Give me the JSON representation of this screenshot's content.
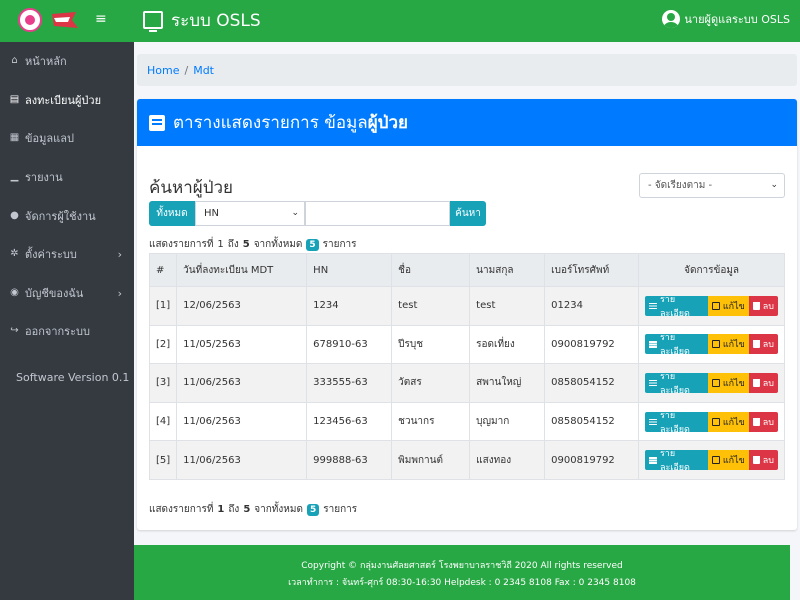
{
  "navbar": {
    "app_title": "ระบบ OSLS",
    "user_name": "นายผู้ดูแลระบบ OSLS"
  },
  "sidebar": {
    "items": [
      {
        "label": "หน้าหลัก",
        "icon": "home-icon"
      },
      {
        "label": "ลงทะเบียนผู้ป่วย",
        "icon": "id-card-icon"
      },
      {
        "label": "ข้อมูลแลป",
        "icon": "database-icon"
      },
      {
        "label": "รายงาน",
        "icon": "chart-icon"
      },
      {
        "label": "จัดการผู้ใช้งาน",
        "icon": "user-plus-icon"
      },
      {
        "label": "ตั้งค่าระบบ",
        "icon": "gears-icon"
      },
      {
        "label": "บัญชีของฉัน",
        "icon": "user-circle-icon"
      },
      {
        "label": "ออกจากระบบ",
        "icon": "sign-out-icon"
      }
    ],
    "version": "Software Version 0.1"
  },
  "breadcrumb": {
    "home": "Home",
    "current": "Mdt"
  },
  "card": {
    "title_prefix": "ตารางแสดงรายการ ข้อมูล",
    "title_bold": "ผู้ป่วย"
  },
  "search": {
    "title": "ค้นหาผู้ป่วย",
    "sort_placeholder": "- จัดเรียงตาม -",
    "all_button": "ทั้งหมด",
    "field_value": "HN",
    "input_value": "",
    "search_button": "ค้นหา"
  },
  "summary_top": {
    "prefix": "แสดงรายการที่",
    "from": "1",
    "to_word": "ถึง",
    "to": "5",
    "total_word": "จากทั้งหมด",
    "total": "5",
    "suffix": "รายการ"
  },
  "table": {
    "headers": [
      "#",
      "วันที่ลงทะเบียน MDT",
      "HN",
      "ชื่อ",
      "นามสกุล",
      "เบอร์โทรศัพท์",
      "จัดการข้อมูล"
    ],
    "rows": [
      {
        "no": "[1]",
        "date": "12/06/2563",
        "hn": "1234",
        "fname": "test",
        "lname": "test",
        "phone": "01234"
      },
      {
        "no": "[2]",
        "date": "11/05/2563",
        "hn": "678910-63",
        "fname": "ปีรบุช",
        "lname": "รอดเที่ยง",
        "phone": "0900819792"
      },
      {
        "no": "[3]",
        "date": "11/06/2563",
        "hn": "333555-63",
        "fname": "วัตสร",
        "lname": "สพานใหญ่",
        "phone": "0858054152"
      },
      {
        "no": "[4]",
        "date": "11/06/2563",
        "hn": "123456-63",
        "fname": "ชวนากร",
        "lname": "บุญมาก",
        "phone": "0858054152"
      },
      {
        "no": "[5]",
        "date": "11/06/2563",
        "hn": "999888-63",
        "fname": "พิมพกานต์",
        "lname": "แสงทอง",
        "phone": "0900819792"
      }
    ],
    "action_labels": {
      "detail": "รายละเอียด",
      "edit": "แก้ไข",
      "delete": "ลบ"
    }
  },
  "summary_bottom": {
    "prefix": "แสดงรายการที่",
    "from": "1",
    "to_word": "ถึง",
    "to": "5",
    "total_word": "จากทั้งหมด",
    "total": "5",
    "suffix": "รายการ"
  },
  "footer": {
    "line1": "Copyright © กลุ่มงานศัลยศาสตร์ โรงพยาบาลราชวิถี 2020 All rights reserved",
    "line2": "เวลาทำการ : จันทร์-ศุกร์ 08:30-16:30 Helpdesk : 0 2345 8108 Fax : 0 2345 8108"
  },
  "colors": {
    "navbar_green": "#28a745",
    "sidebar_dark": "#343a40",
    "primary_blue": "#007bff",
    "info_teal": "#17a2b8",
    "warning_yellow": "#ffc107",
    "danger_red": "#dc3545"
  }
}
